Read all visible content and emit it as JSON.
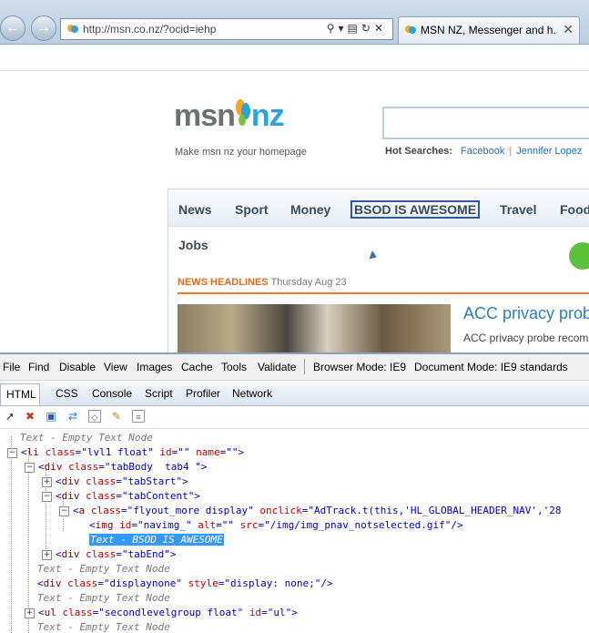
{
  "browser": {
    "address": "http://msn.co.nz/?ocid=iehp",
    "tab_title": "MSN NZ, Messenger and h...",
    "tab_close": "✕",
    "back_icon": "back-arrow-icon",
    "forward_icon": "forward-arrow-icon"
  },
  "page": {
    "logo_msn": "msn",
    "logo_nz": "nz",
    "tagline": "Make msn nz your homepage",
    "hot_label": "Hot Searches:",
    "hot_links": [
      "Facebook",
      "Jennifer Lopez"
    ],
    "nav": [
      "News",
      "Sport",
      "Money",
      "BSOD IS AWESOME",
      "Travel",
      "Food"
    ],
    "jobs": "Jobs",
    "headlines_label": "NEWS HEADLINES",
    "headlines_date": "Thursday Aug 23",
    "story_title": "ACC privacy prob",
    "story_body": "ACC privacy probe recom"
  },
  "devtools": {
    "menu": [
      "File",
      "Find",
      "Disable",
      "View",
      "Images",
      "Cache",
      "Tools",
      "Validate"
    ],
    "browser_mode": "Browser Mode: IE9",
    "document_mode": "Document Mode: IE9 standards",
    "tabs": [
      "HTML",
      "CSS",
      "Console",
      "Script",
      "Profiler",
      "Network"
    ],
    "tree": {
      "empty_text": "Text - Empty Text Node",
      "li": {
        "tag": "li",
        "class": "lvl1 float",
        "id": "",
        "name": ""
      },
      "tabbody": {
        "tag": "div",
        "class": "tabBody  tab4 "
      },
      "tabstart": {
        "tag": "div",
        "class": "tabStart"
      },
      "tabcontent": {
        "tag": "div",
        "class": "tabContent"
      },
      "anchor": {
        "tag": "a",
        "class": "flyout_more display",
        "onclick": "AdTrack.t(this,'HL_GLOBAL_HEADER_NAV','28"
      },
      "img": {
        "tag": "img",
        "id": "navimg_",
        "alt": "",
        "src": "/img/img_pnav_notselected.gif"
      },
      "selected_text": "Text - BSOD IS AWESOME",
      "tabend": {
        "tag": "div",
        "class": "tabEnd"
      },
      "displaynone": {
        "tag": "div",
        "class": "displaynone",
        "style": "display: none;"
      },
      "ul": {
        "tag": "ul",
        "class": "secondlevelgroup float",
        "id": "ul"
      }
    }
  }
}
